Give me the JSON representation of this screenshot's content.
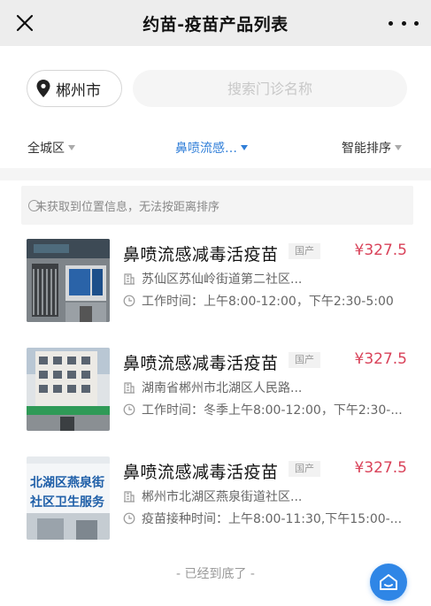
{
  "header": {
    "title": "约苗-疫苗产品列表"
  },
  "location": {
    "city": "郴州市"
  },
  "search": {
    "placeholder": "搜索门诊名称",
    "value": ""
  },
  "filters": {
    "area": "全城区",
    "vaccine": "鼻喷流感…",
    "sort": "智能排序",
    "active_color": "#2f7ed8"
  },
  "notice": {
    "text": "未获取到位置信息，无法按距离排序"
  },
  "clinics": [
    {
      "name": "鼻喷流感减毒活疫苗",
      "tag": "国产",
      "price": "¥327.5",
      "address": "苏仙区苏仙岭街道第二社区...",
      "hours": "工作时间：上午8:00-12:00，下午2:30-5:00"
    },
    {
      "name": "鼻喷流感减毒活疫苗",
      "tag": "国产",
      "price": "¥327.5",
      "address": "湖南省郴州市北湖区人民路...",
      "hours": "工作时间：冬季上午8:00-12:00，下午2:30-..."
    },
    {
      "name": "鼻喷流感减毒活疫苗",
      "tag": "国产",
      "price": "¥327.5",
      "address": "郴州市北湖区燕泉街道社区...",
      "hours": "疫苗接种时间：上午8:00-11:30,下午15:00-..."
    }
  ],
  "thumb_text": {
    "clinic3_sign_line1": "北湖区燕泉街",
    "clinic3_sign_line2": "社区卫生服务"
  },
  "footer": {
    "end_text": "- 已经到底了 -"
  },
  "colors": {
    "price": "#d9435a",
    "accent": "#2f86e6"
  },
  "icons": {
    "close": "close-icon",
    "more": "more-dots-icon",
    "location": "location-pin-icon",
    "info": "info-icon",
    "building": "building-icon",
    "clock": "clock-icon",
    "home": "home-icon"
  }
}
